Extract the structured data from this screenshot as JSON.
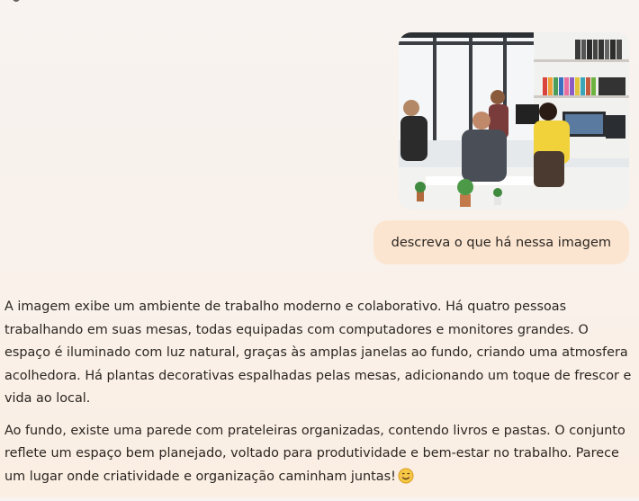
{
  "conversation": {
    "user_message": {
      "image_alt": "office-photo",
      "text": "descreva o que há nessa imagem"
    },
    "assistant_message": {
      "paragraphs": [
        "A imagem exibe um ambiente de trabalho moderno e colaborativo. Há quatro pessoas trabalhando em suas mesas, todas equipadas com computadores e monitores grandes. O espaço é iluminado com luz natural, graças às amplas janelas ao fundo, criando uma atmosfera acolhedora. Há plantas decorativas espalhadas pelas mesas, adicionando um toque de frescor e vida ao local.",
        "Ao fundo, existe uma parede com prateleiras organizadas, contendo livros e pastas. O conjunto reflete um espaço bem planejado, voltado para produtividade e bem-estar no trabalho. Parece um lugar onde criatividade e organização caminham juntas!"
      ],
      "trailing_emoji": "smiling-face-emoji"
    }
  },
  "colors": {
    "user_bubble": "#fbe5d0",
    "text": "#2b2622",
    "background": "#f8f3f0"
  }
}
